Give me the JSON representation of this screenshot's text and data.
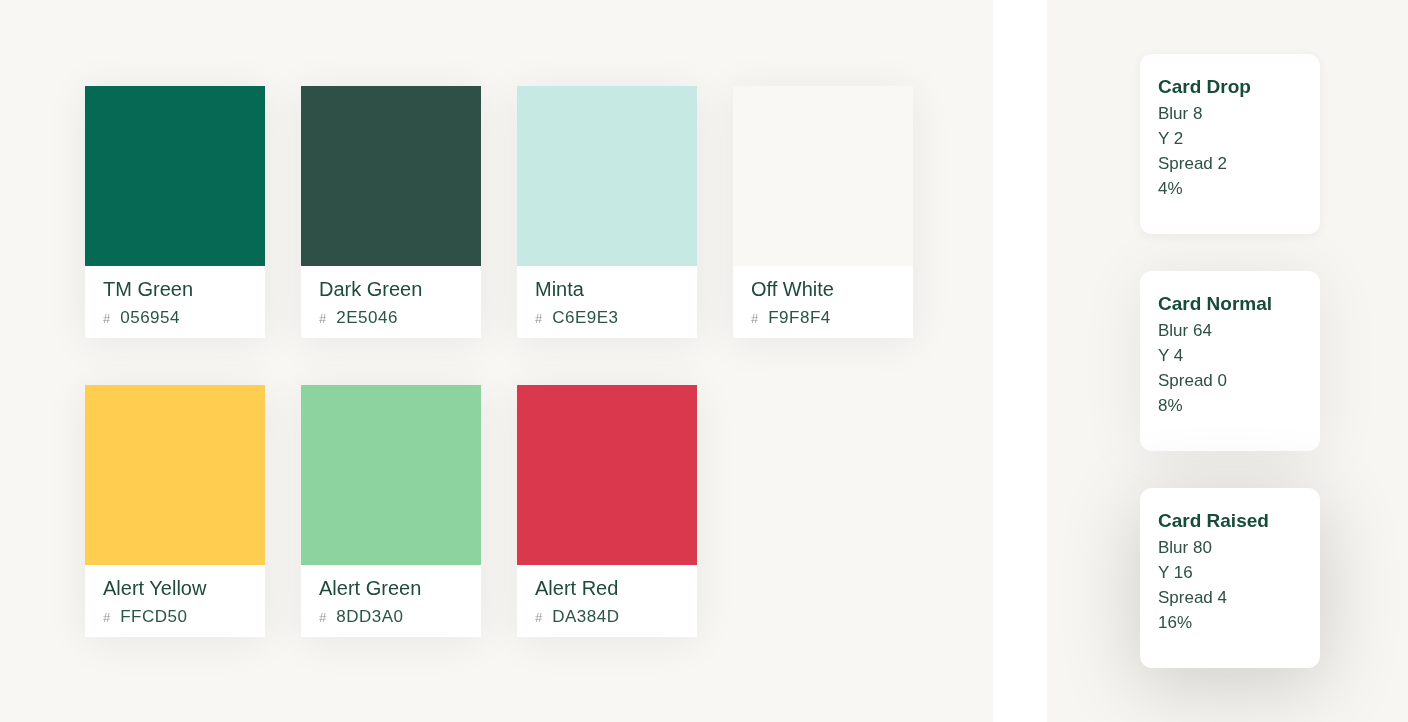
{
  "swatches": [
    {
      "name": "TM Green",
      "prefix": "#",
      "code": "056954",
      "color": "#056954"
    },
    {
      "name": "Dark Green",
      "prefix": "#",
      "code": "2E5046",
      "color": "#2e5046"
    },
    {
      "name": "Minta",
      "prefix": "#",
      "code": "C6E9E3",
      "color": "#c6e9e3"
    },
    {
      "name": "Off White",
      "prefix": "#",
      "code": "F9F8F4",
      "color": "#f9f8f4"
    },
    {
      "name": "Alert Yellow",
      "prefix": "#",
      "code": "FFCD50",
      "color": "#ffcd50"
    },
    {
      "name": "Alert Green",
      "prefix": "#",
      "code": "8DD3A0",
      "color": "#8dd3a0"
    },
    {
      "name": "Alert Red",
      "prefix": "#",
      "code": "DA384D",
      "color": "#da384d"
    }
  ],
  "shadow_cards": [
    {
      "kind": "drop",
      "title": "Card Drop",
      "lines": [
        "Blur 8",
        "Y 2",
        "Spread 2",
        "4%"
      ]
    },
    {
      "kind": "normal",
      "title": "Card Normal",
      "lines": [
        "Blur 64",
        "Y 4",
        "Spread 0",
        "8%"
      ]
    },
    {
      "kind": "raised",
      "title": "Card Raised",
      "lines": [
        "Blur 80",
        "Y 16",
        "Spread 4",
        "16%"
      ]
    }
  ]
}
